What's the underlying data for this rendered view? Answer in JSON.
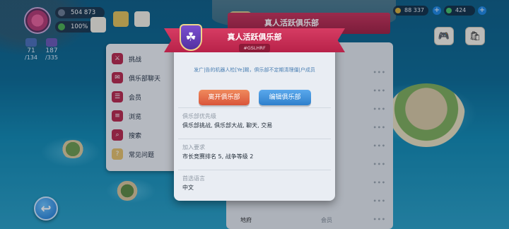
{
  "hud": {
    "coins": "504 873",
    "energy": "100%",
    "stat1": {
      "value": "71",
      "max": "/134"
    },
    "stat2": {
      "value": "187",
      "max": "/335"
    },
    "right_currency": "88 337",
    "right_gems": "424"
  },
  "background_panel": {
    "title": "真人活跃俱乐部",
    "rows": [
      {
        "name": "",
        "role": "",
        "dots": "•••"
      },
      {
        "name": "",
        "role": "",
        "dots": "•••"
      },
      {
        "name": "",
        "role": "",
        "dots": "•••"
      },
      {
        "name": "",
        "role": "",
        "dots": "•••"
      },
      {
        "name": "",
        "role": "",
        "dots": "•••"
      },
      {
        "name": "",
        "role": "",
        "dots": "•••"
      },
      {
        "name": "",
        "role": "",
        "dots": "•••"
      },
      {
        "name": "",
        "role": "",
        "dots": "•••"
      },
      {
        "name": "地府",
        "role": "会员",
        "dots": "•••"
      }
    ]
  },
  "side_menu": {
    "items": [
      {
        "label": "挑战",
        "icon": "sword-icon"
      },
      {
        "label": "俱乐部聊天",
        "icon": "chat-icon"
      },
      {
        "label": "会员",
        "icon": "members-icon"
      },
      {
        "label": "浏览",
        "icon": "browse-icon"
      },
      {
        "label": "搜索",
        "icon": "search-icon"
      },
      {
        "label": "常见问题",
        "icon": "book-icon"
      }
    ]
  },
  "modal": {
    "title": "真人活跃俱乐部",
    "tag": "#GSLHRF",
    "description": "发广|告的机器人检[Ye]踢，俱乐部不定期清理僵|户成员",
    "leave_button": "离开俱乐部",
    "edit_button": "编辑俱乐部",
    "sections": [
      {
        "label": "俱乐部优先级",
        "value": "俱乐部挑战, 俱乐部大战, 聊天, 交易"
      },
      {
        "label": "加入要求",
        "value": "市长竞赛排名 5, 战争等级 2"
      },
      {
        "label": "首选语言",
        "value": "中文"
      }
    ]
  },
  "colors": {
    "ribbon": "#c9325a",
    "leave": "#d9553a",
    "edit": "#2f80cc",
    "badge": "#6a3db0"
  }
}
